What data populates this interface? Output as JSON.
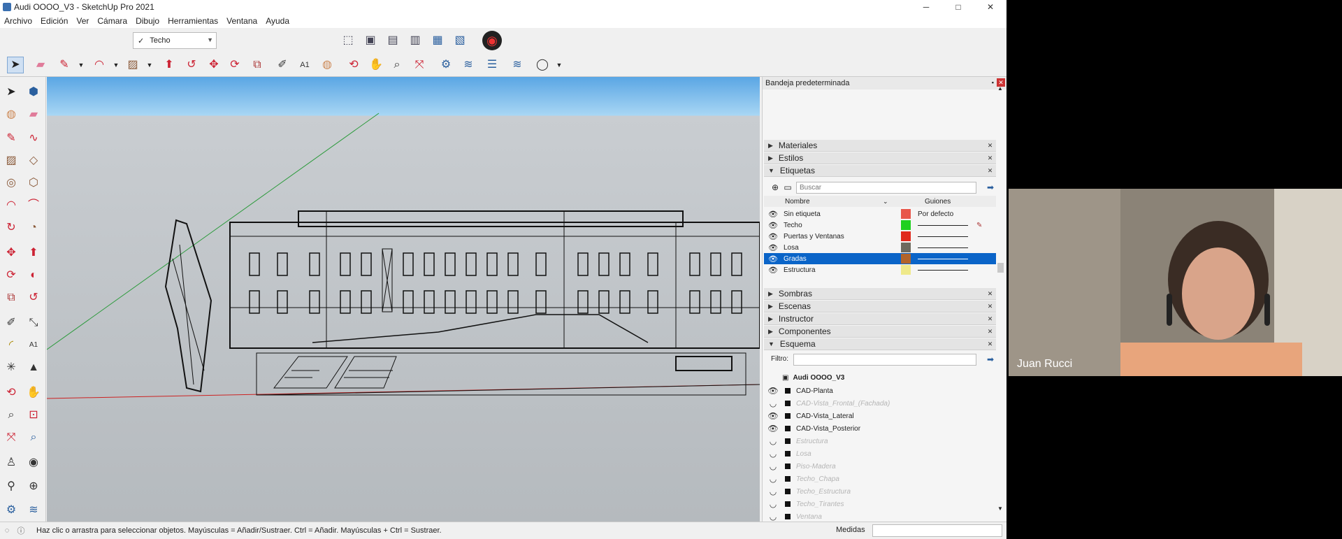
{
  "window": {
    "title": "Audi OOOO_V3 - SketchUp Pro 2021",
    "minimize": "─",
    "maximize": "□",
    "close": "✕"
  },
  "menu": [
    "Archivo",
    "Edición",
    "Ver",
    "Cámara",
    "Dibujo",
    "Herramientas",
    "Ventana",
    "Ayuda"
  ],
  "tag_selector": {
    "check": "✓",
    "value": "Techo"
  },
  "tray": {
    "title": "Bandeja predeterminada",
    "panels": {
      "materiales": "Materiales",
      "estilos": "Estilos",
      "etiquetas": "Etiquetas",
      "sombras": "Sombras",
      "escenas": "Escenas",
      "instructor": "Instructor",
      "componentes": "Componentes",
      "esquema": "Esquema"
    },
    "tags": {
      "search_placeholder": "Buscar",
      "col_name": "Nombre",
      "col_dashes": "Guiones",
      "rows": [
        {
          "name": "Sin etiqueta",
          "color": "#e8564a",
          "dash": "Por defecto"
        },
        {
          "name": "Techo",
          "color": "#1fd01f",
          "dash": ""
        },
        {
          "name": "Puertas y Ventanas",
          "color": "#e02a1c",
          "dash": ""
        },
        {
          "name": "Losa",
          "color": "#6e6a5e",
          "dash": ""
        },
        {
          "name": "Gradas",
          "color": "#b2642a",
          "dash": ""
        },
        {
          "name": "Estructura",
          "color": "#efe98a",
          "dash": ""
        }
      ]
    },
    "outliner": {
      "filter_label": "Filtro:",
      "model": "Audi OOOO_V3",
      "items": [
        {
          "name": "CAD-Planta",
          "visible": true
        },
        {
          "name": "CAD-Vista_Frontal_(Fachada)",
          "visible": false
        },
        {
          "name": "CAD-Vista_Lateral",
          "visible": true
        },
        {
          "name": "CAD-Vista_Posterior",
          "visible": true
        },
        {
          "name": "Estructura",
          "visible": false
        },
        {
          "name": "Losa",
          "visible": false
        },
        {
          "name": "Piso-Madera",
          "visible": false
        },
        {
          "name": "Techo_Chapa",
          "visible": false
        },
        {
          "name": "Techo_Estructura",
          "visible": false
        },
        {
          "name": "Techo_Tirantes",
          "visible": false
        },
        {
          "name": "Ventana",
          "visible": false
        }
      ]
    }
  },
  "status": {
    "message": "Haz clic o arrastra para seleccionar objetos. Mayúsculas = Añadir/Sustraer. Ctrl = Añadir. Mayúsculas + Ctrl = Sustraer.",
    "measure_label": "Medidas"
  },
  "webcam": {
    "name": "Juan Rucci"
  },
  "colors": {
    "selected": "#0a64c8",
    "sky": "#5aa6e4",
    "ground": "#b5babe"
  }
}
